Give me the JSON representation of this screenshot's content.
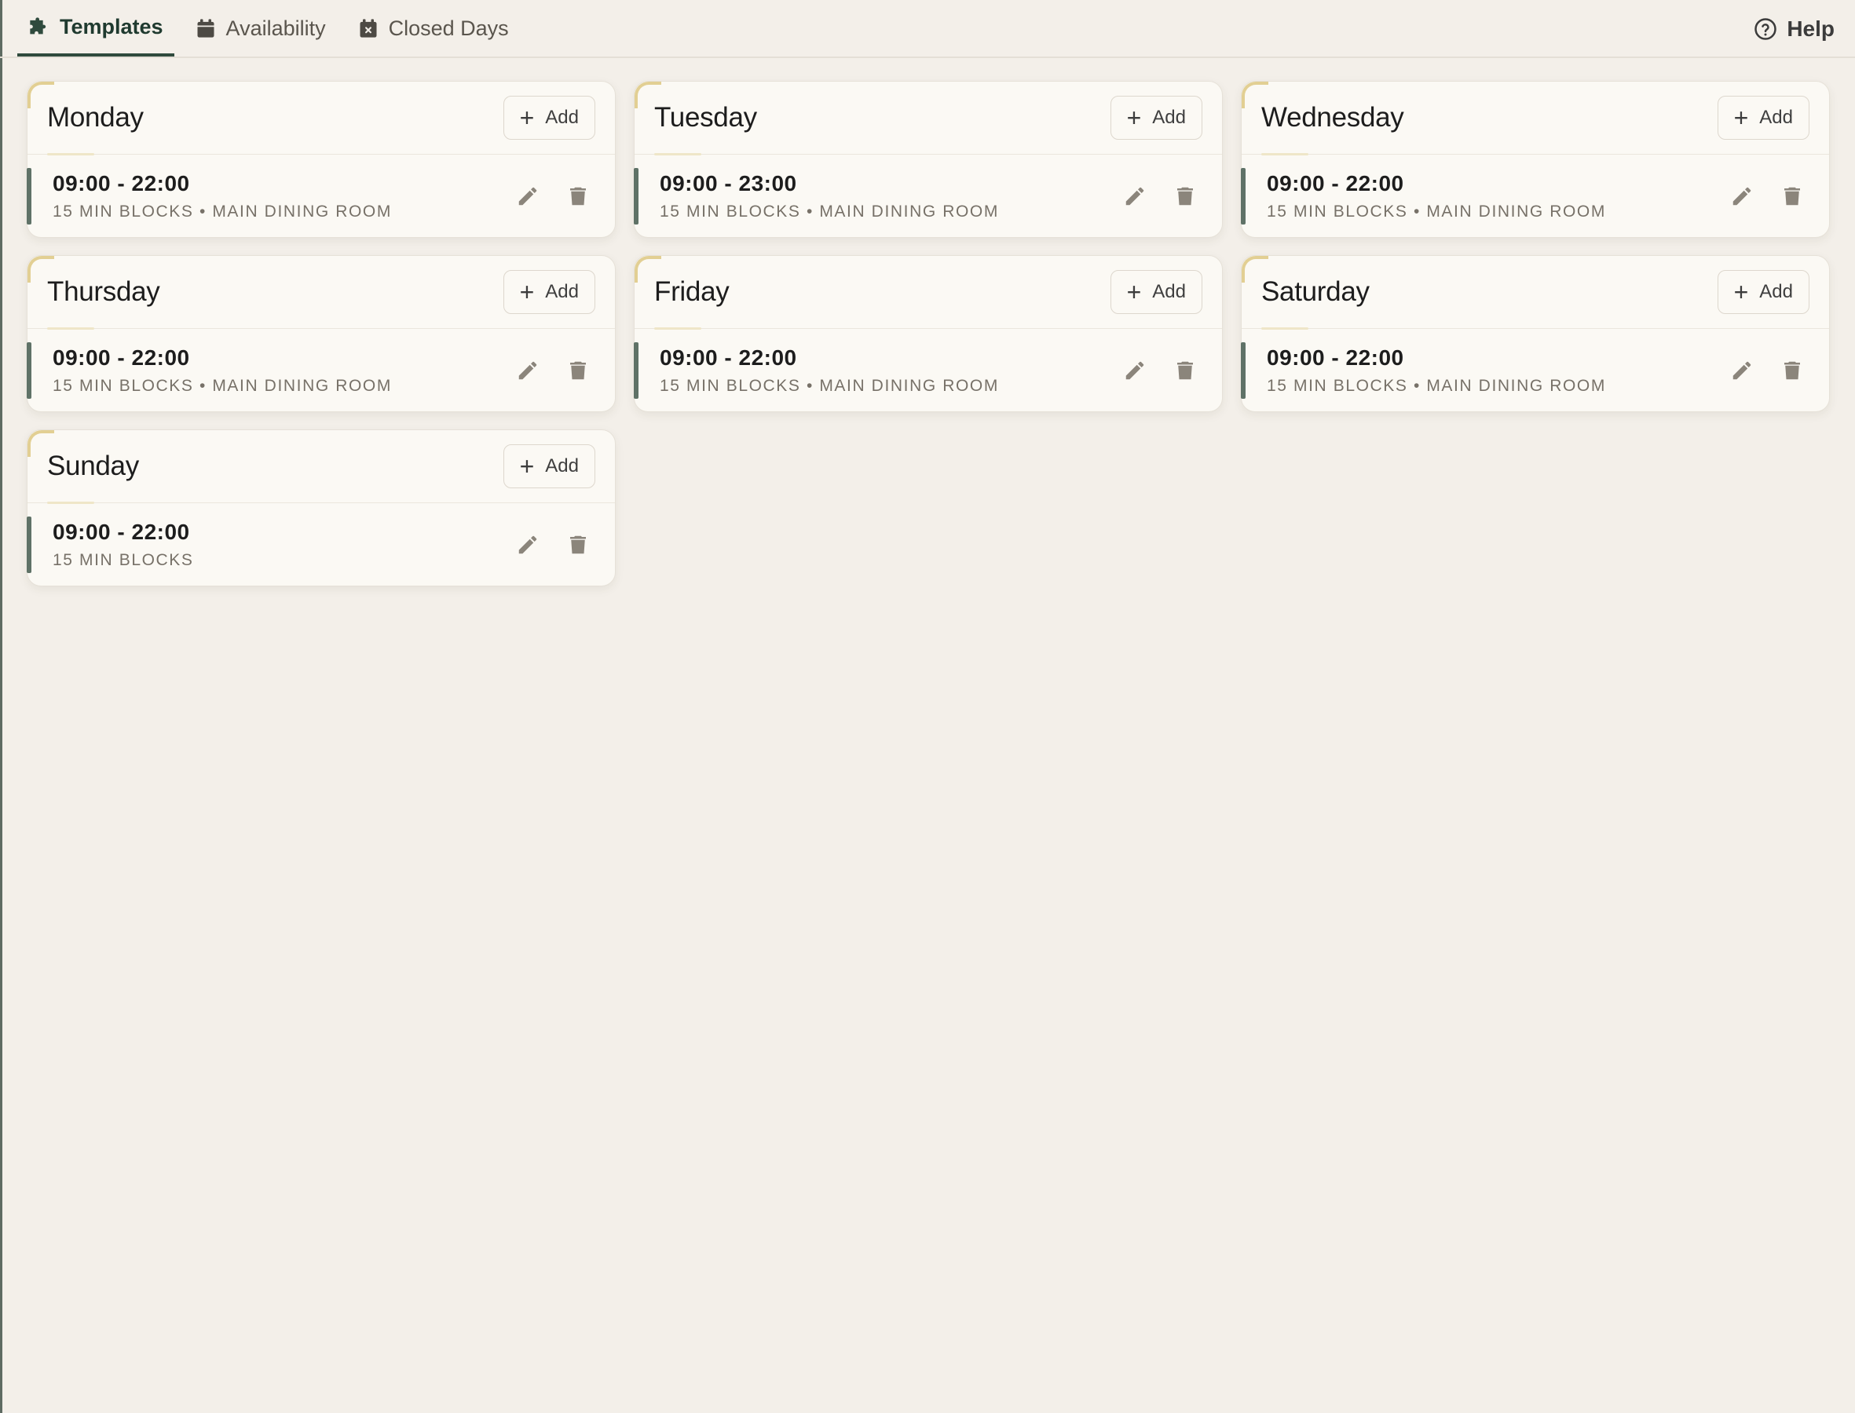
{
  "tabs": [
    {
      "label": "Templates",
      "icon": "puzzle-icon",
      "active": true
    },
    {
      "label": "Availability",
      "icon": "calendar-icon",
      "active": false
    },
    {
      "label": "Closed Days",
      "icon": "calendar-x-icon",
      "active": false
    }
  ],
  "help": {
    "label": "Help",
    "icon": "help-circle-icon"
  },
  "add_label": "Add",
  "days": [
    {
      "name": "Monday",
      "slot": {
        "time": "09:00 - 22:00",
        "meta": "15 MIN BLOCKS • MAIN DINING ROOM"
      }
    },
    {
      "name": "Tuesday",
      "slot": {
        "time": "09:00 - 23:00",
        "meta": "15 MIN BLOCKS • MAIN DINING ROOM"
      }
    },
    {
      "name": "Wednesday",
      "slot": {
        "time": "09:00 - 22:00",
        "meta": "15 MIN BLOCKS • MAIN DINING ROOM"
      }
    },
    {
      "name": "Thursday",
      "slot": {
        "time": "09:00 - 22:00",
        "meta": "15 MIN BLOCKS • MAIN DINING ROOM"
      }
    },
    {
      "name": "Friday",
      "slot": {
        "time": "09:00 - 22:00",
        "meta": "15 MIN BLOCKS • MAIN DINING ROOM"
      }
    },
    {
      "name": "Saturday",
      "slot": {
        "time": "09:00 - 22:00",
        "meta": "15 MIN BLOCKS • MAIN DINING ROOM"
      }
    },
    {
      "name": "Sunday",
      "slot": {
        "time": "09:00 - 22:00",
        "meta": "15 MIN BLOCKS"
      }
    }
  ],
  "colors": {
    "accent": "#2f4a3d",
    "slot_bar": "#5f7267",
    "corner": "#e2cf93",
    "background": "#f3efe9"
  }
}
